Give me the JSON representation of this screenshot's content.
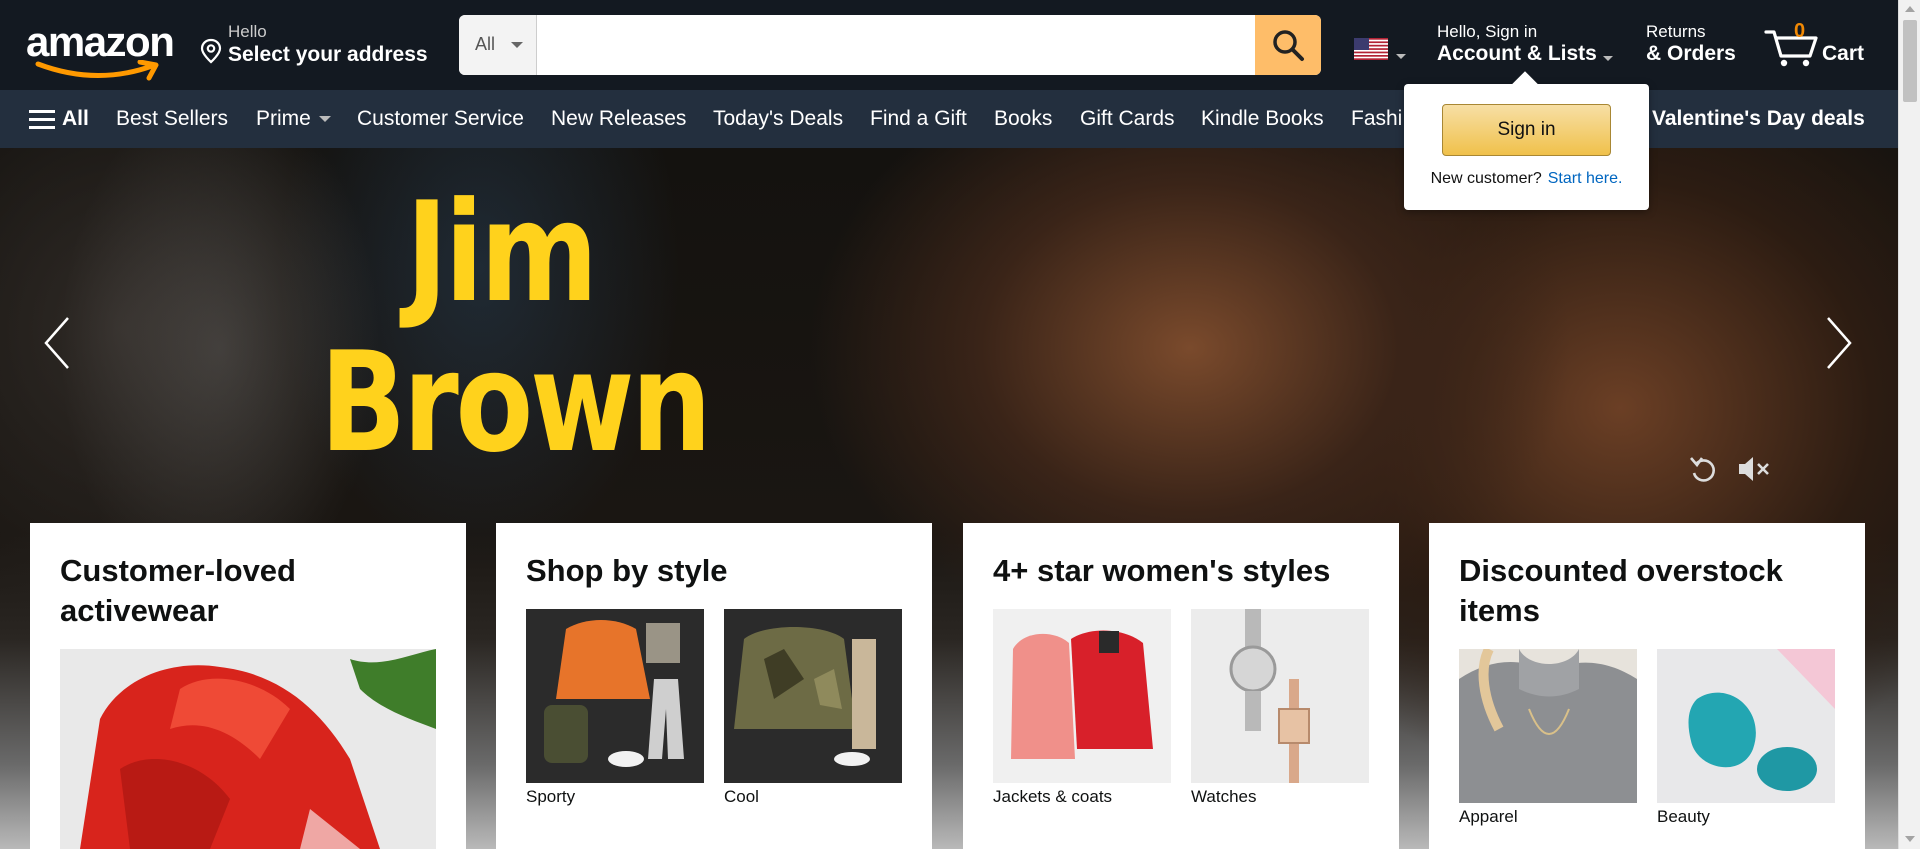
{
  "header": {
    "logo_text": "amazon",
    "deliver_line1": "Hello",
    "deliver_line2": "Select your address",
    "search_department": "All",
    "search_placeholder": "",
    "account_line1": "Hello, Sign in",
    "account_line2": "Account & Lists",
    "orders_line1": "Returns",
    "orders_line2": "& Orders",
    "cart_count": "0",
    "cart_label": "Cart"
  },
  "nav": {
    "all_label": "All",
    "items": [
      "Best Sellers",
      "Prime",
      "Customer Service",
      "New Releases",
      "Today's Deals",
      "Find a Gift",
      "Books",
      "Gift Cards",
      "Kindle Books",
      "Fashi"
    ],
    "promo": "Valentine's Day deals"
  },
  "flyout": {
    "signin_label": "Sign in",
    "new_customer_text": "New customer?",
    "start_here_link": "Start here."
  },
  "hero": {
    "title_line1": "Jim",
    "title_line2": "Brown"
  },
  "cards": [
    {
      "title": "Customer-loved activewear",
      "tiles": []
    },
    {
      "title": "Shop by style",
      "tiles": [
        {
          "caption": "Sporty"
        },
        {
          "caption": "Cool"
        }
      ]
    },
    {
      "title": "4+ star women's styles",
      "tiles": [
        {
          "caption": "Jackets & coats"
        },
        {
          "caption": "Watches"
        }
      ]
    },
    {
      "title": "Discounted overstock items",
      "tiles": [
        {
          "caption": "Apparel"
        },
        {
          "caption": "Beauty"
        }
      ]
    }
  ],
  "icons": {
    "search": "search-icon",
    "location": "location-pin-icon",
    "flag": "us-flag-icon",
    "cart": "cart-icon",
    "menu": "hamburger-menu-icon",
    "prev": "chevron-left-icon",
    "next": "chevron-right-icon",
    "replay": "replay-icon",
    "mute": "mute-icon"
  },
  "colors": {
    "header_bg": "#131921",
    "nav_bg": "#232f3e",
    "search_button": "#febd69",
    "cart_count": "#f08804",
    "hero_title": "#ffd21c",
    "signin_button": "#f0c14b",
    "link": "#0066c0"
  }
}
